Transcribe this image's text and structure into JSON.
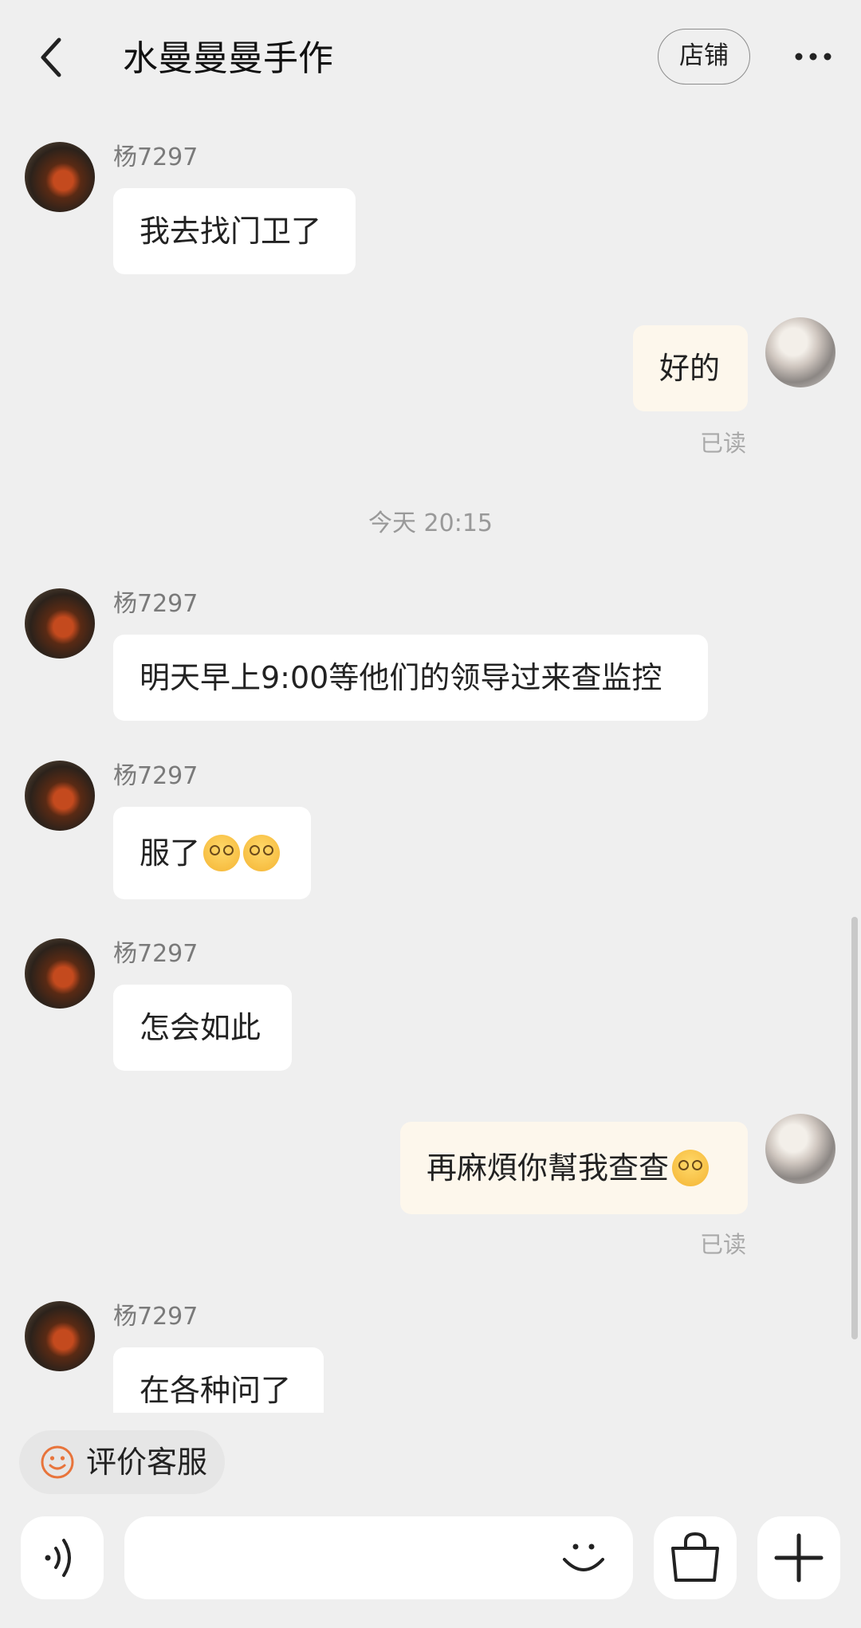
{
  "header": {
    "title": "水曼曼曼手作",
    "shop_button": "店铺"
  },
  "messages": [
    {
      "sender": "杨7297",
      "text": "我去找门卫了"
    },
    {
      "text": "好的",
      "read": "已读"
    },
    {
      "timestamp": "今天  20:15"
    },
    {
      "sender": "杨7297",
      "text": "明天早上9:00等他们的领导过来查监控"
    },
    {
      "sender": "杨7297",
      "text": "服了"
    },
    {
      "sender": "杨7297",
      "text": "怎会如此"
    },
    {
      "text": "再麻煩你幫我查查",
      "read": "已读"
    },
    {
      "sender": "杨7297",
      "text": "在各种问了"
    }
  ],
  "rate_chip": {
    "label": "评价客服"
  },
  "input": {
    "placeholder": ""
  },
  "colors": {
    "background": "#efefef",
    "incoming_bubble": "#ffffff",
    "outgoing_bubble": "#fdf7ec",
    "accent_orange": "#e8743b"
  },
  "icons": [
    "back-arrow-icon",
    "more-dots-icon",
    "smiley-icon",
    "voice-icon",
    "emoji-icon",
    "shopping-bag-icon",
    "plus-icon"
  ]
}
